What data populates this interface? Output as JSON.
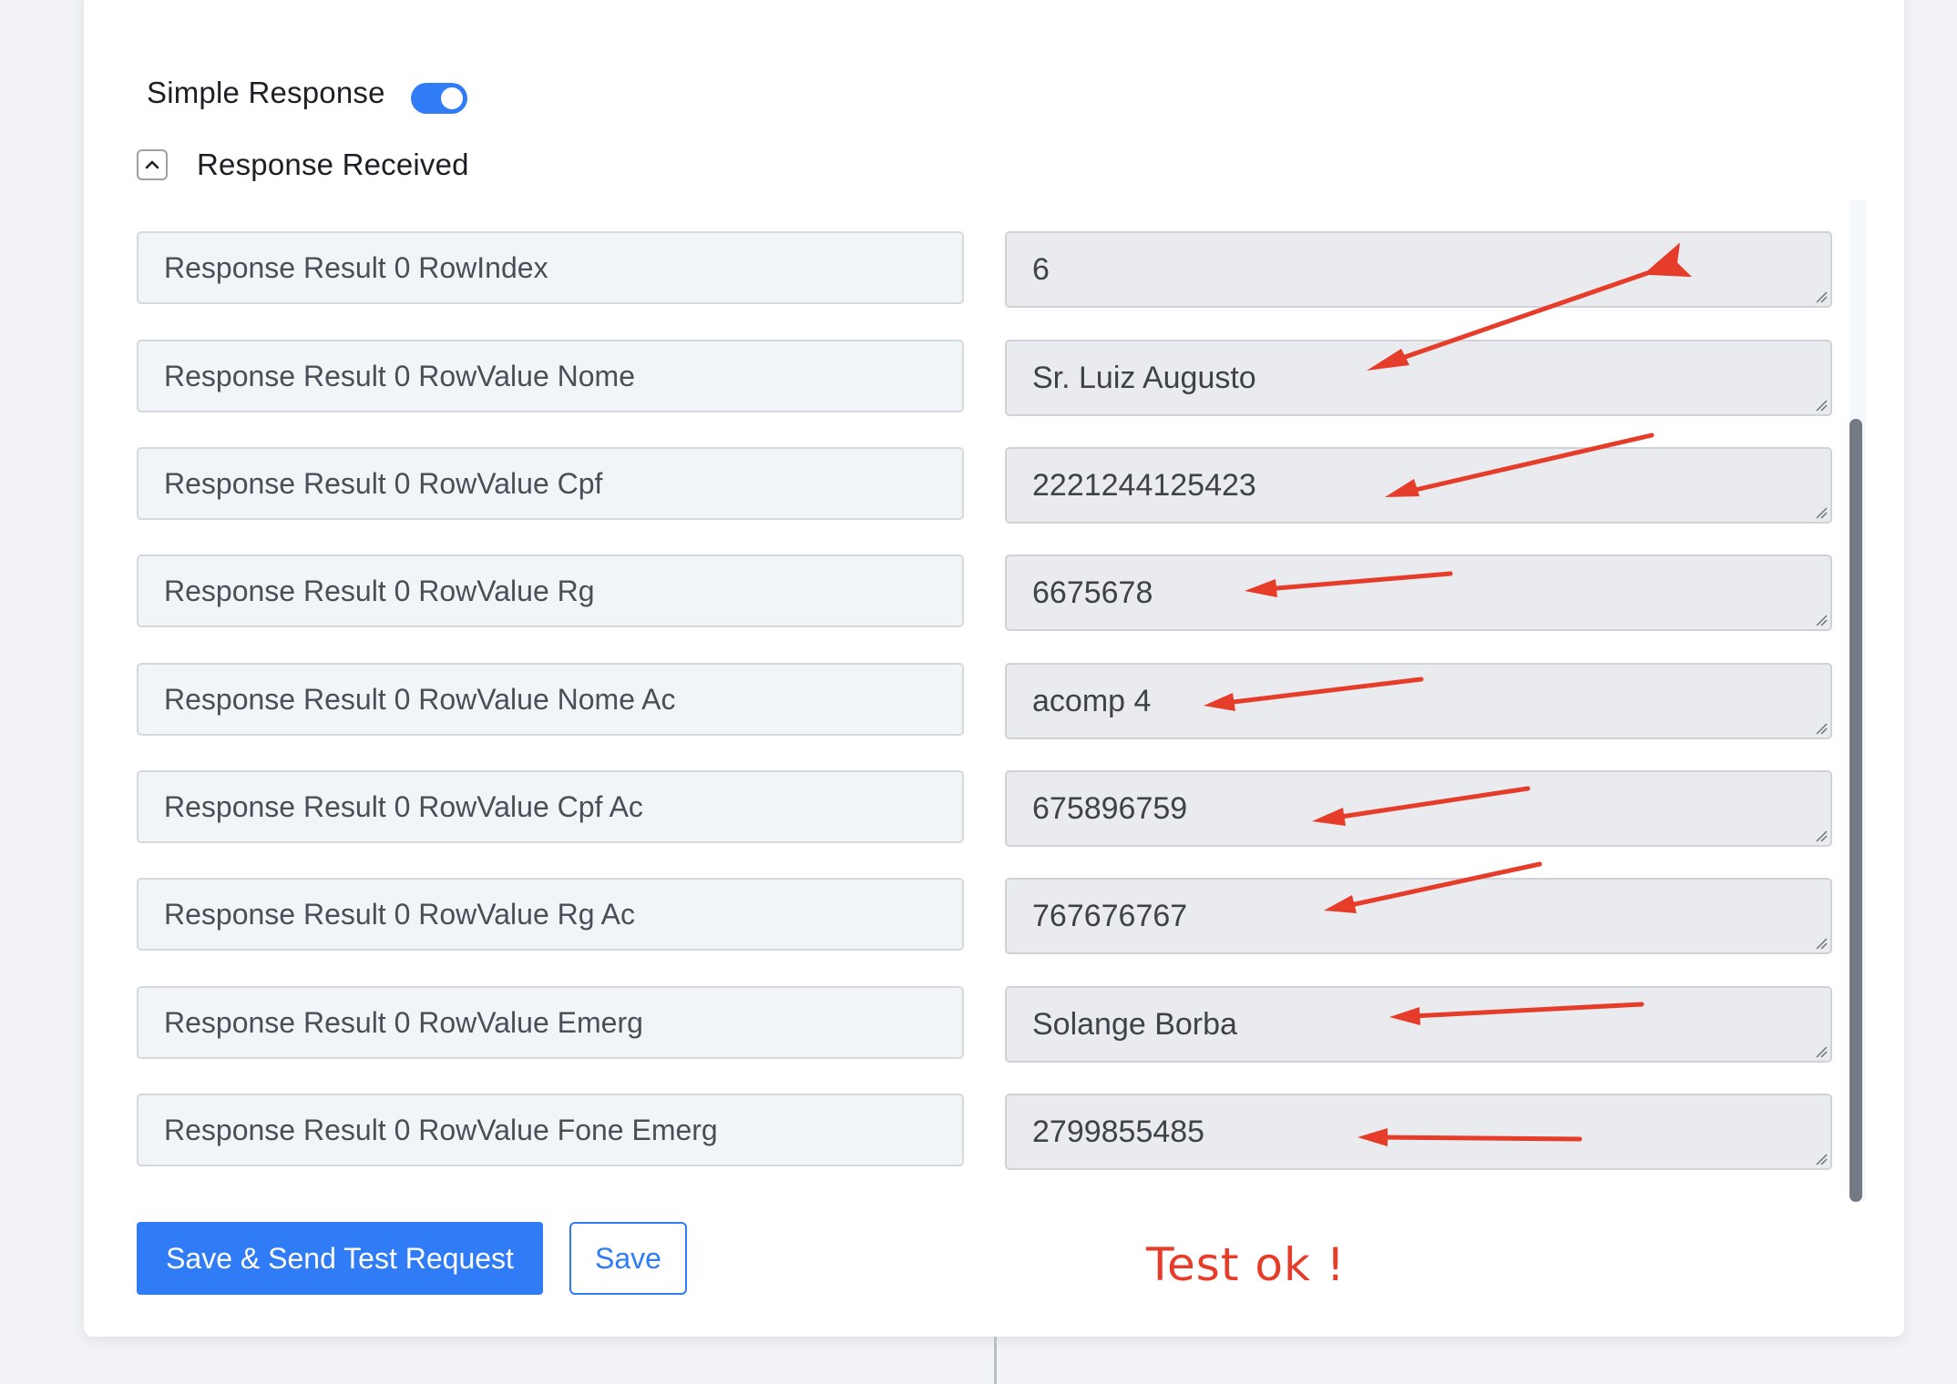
{
  "simple_response": {
    "label": "Simple Response",
    "enabled": true
  },
  "response_received": {
    "label": "Response Received",
    "expanded": true
  },
  "rows": [
    {
      "key": "Response Result 0 RowIndex",
      "value": "6"
    },
    {
      "key": "Response Result 0 RowValue Nome",
      "value": "Sr. Luiz Augusto"
    },
    {
      "key": "Response Result 0 RowValue Cpf",
      "value": "2221244125423"
    },
    {
      "key": "Response Result 0 RowValue Rg",
      "value": "6675678"
    },
    {
      "key": "Response Result 0 RowValue Nome Ac",
      "value": "acomp 4"
    },
    {
      "key": "Response Result 0 RowValue Cpf Ac",
      "value": "675896759"
    },
    {
      "key": "Response Result 0 RowValue Rg Ac",
      "value": "767676767"
    },
    {
      "key": "Response Result 0 RowValue Emerg",
      "value": "Solange Borba"
    },
    {
      "key": "Response Result 0 RowValue Fone Emerg",
      "value": "2799855485"
    }
  ],
  "actions": {
    "save_and_send_label": "Save & Send Test Request",
    "save_label": "Save"
  },
  "annotation": {
    "text": "Test ok !",
    "color": "#e63c2a"
  },
  "colors": {
    "accent": "#2f7cf6",
    "annotation_red": "#e63c2a"
  }
}
